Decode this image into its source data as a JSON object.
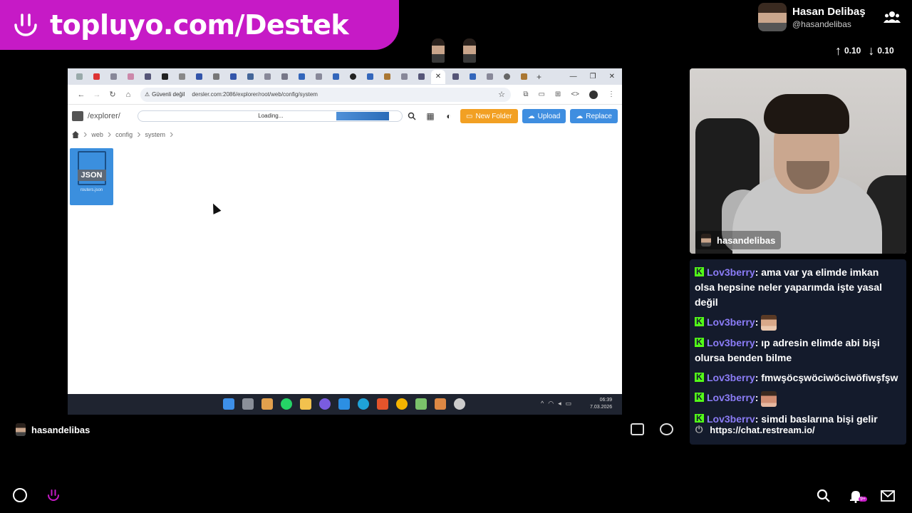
{
  "banner": {
    "text": "topluyo.com/Destek"
  },
  "profile": {
    "name": "Hasan Delibaş",
    "handle": "@hasandelibas"
  },
  "rates": {
    "up": "0.10",
    "down": "0.10"
  },
  "browser": {
    "security": "Güvenli değil",
    "url": "dersler.com:2086/explorer/root/web/config/system",
    "path": "/explorer/",
    "progress_label": "Loading...",
    "progress": 0.2,
    "buttons": {
      "new_folder": "New Folder",
      "upload": "Upload",
      "replace": "Replace"
    },
    "breadcrumbs": [
      "web",
      "config",
      "system"
    ],
    "file": {
      "badge": "JSON",
      "name": "routers.json"
    },
    "clock": {
      "time": "06:39",
      "date": "7.03.2026"
    }
  },
  "cam": {
    "label": "hasandelibas"
  },
  "chat": {
    "messages": [
      {
        "user": "Lov3berry",
        "text": "ama var ya elimde imkan olsa hepsine neler yaparımda işte yasal değil"
      },
      {
        "user": "Lov3berry",
        "emote": "emote-face"
      },
      {
        "user": "Lov3berry",
        "text": "ıp adresin elimde abi bişi olursa benden bilme"
      },
      {
        "user": "Lov3berry",
        "text": "fmwşöcşwöciwöciwöfiwşfşw"
      },
      {
        "user": "Lov3berry",
        "emote": "emote-face"
      },
      {
        "user": "Lov3berry",
        "text": "simdi baslarına bişi gelir"
      }
    ],
    "link": "https://chat.restream.io/"
  },
  "bottom": {
    "username": "hasandelibas",
    "notif_badge": "9+"
  },
  "colors": {
    "brand": "#c61ac6",
    "chat_bg": "#141b2c",
    "username": "#8b7cf7",
    "kick": "#53fc18"
  }
}
